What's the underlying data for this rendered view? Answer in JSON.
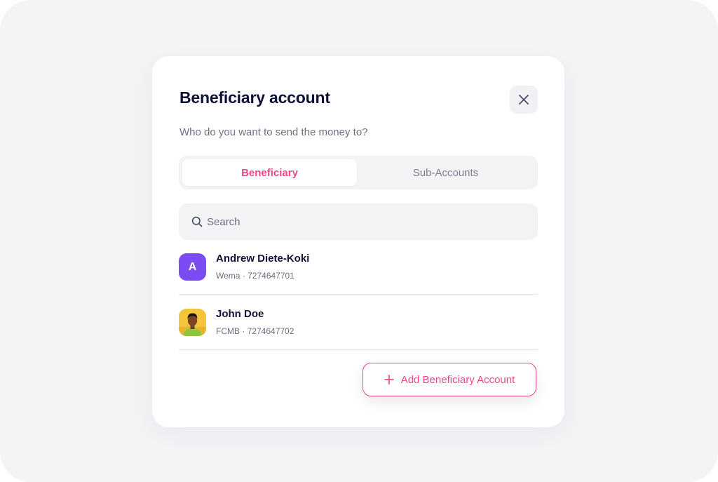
{
  "modal": {
    "title": "Beneficiary account",
    "subtitle": "Who do you want to send the money to?"
  },
  "tabs": [
    {
      "label": "Beneficiary",
      "active": true
    },
    {
      "label": "Sub-Accounts",
      "active": false
    }
  ],
  "search": {
    "placeholder": "Search",
    "value": ""
  },
  "beneficiaries": [
    {
      "initial": "A",
      "name": "Andrew Diete-Koki",
      "details": "Wema · 7274647701",
      "avatar": "letter-avatar"
    },
    {
      "name": "John Doe",
      "details": "FCMB · 7274647702",
      "avatar": "person-photo-avatar"
    }
  ],
  "actions": {
    "add_label": "Add Beneficiary Account"
  },
  "icons": {
    "close": "close-icon",
    "search": "search-icon",
    "add": "plus-icon"
  },
  "colors": {
    "accent": "#f0478b",
    "avatar_purple": "#7a4cf2",
    "title": "#0f1238",
    "muted": "#6e7085",
    "surface": "#f3f3f6"
  }
}
